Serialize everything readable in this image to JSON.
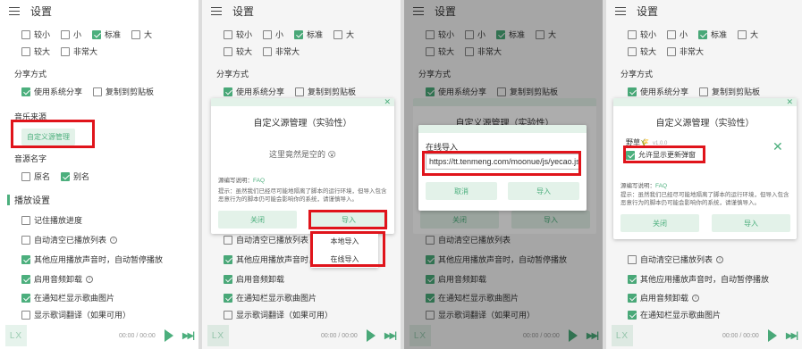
{
  "header": {
    "title": "设置"
  },
  "font_sizes": [
    "较小",
    "小",
    "标准",
    "大",
    "较大",
    "非常大"
  ],
  "share": {
    "section": "分享方式",
    "opt1": "使用系统分享",
    "opt2": "复制到剪贴板"
  },
  "music_source": {
    "section": "音乐来源",
    "button": "自定义源管理"
  },
  "music_name": {
    "section": "音源名字",
    "opt1": "原名",
    "opt2": "别名"
  },
  "playback": {
    "section": "播放设置",
    "items": [
      "记住播放进度",
      "自动清空已播放列表",
      "其他应用播放声音时，自动暂停播放",
      "启用音频卸载",
      "在通知栏显示歌曲图片",
      "显示歌词翻译（如果可用）"
    ]
  },
  "player": {
    "logo": "LX",
    "time": "00:00 / 00:00"
  },
  "dialog": {
    "title": "自定义源管理（实验性）",
    "empty_text": "这里竟然是空的 😮",
    "link_label": "源编写说明：",
    "link_text": "FAQ",
    "tip": "提示：虽然我们已经尽可能地隔离了脚本的运行环境，但导入包含恶意行为的脚本仍可能会影响你的系统，请谨慎导入。",
    "close": "关闭",
    "import": "导入"
  },
  "import_menu": {
    "local": "本地导入",
    "online": "在线导入"
  },
  "online_dialog": {
    "label": "在线导入",
    "url": "https://tt.tenmeng.com/moonue/js/yecao.js",
    "cancel": "取消",
    "confirm": "导入"
  },
  "source_item": {
    "name": "野草🌾",
    "version": "v1.0.0",
    "option": "允许显示更新弹窗"
  },
  "colors": {
    "accent": "#4caf7d",
    "accent_light": "#e3f2e9",
    "highlight": "#e0141b"
  }
}
